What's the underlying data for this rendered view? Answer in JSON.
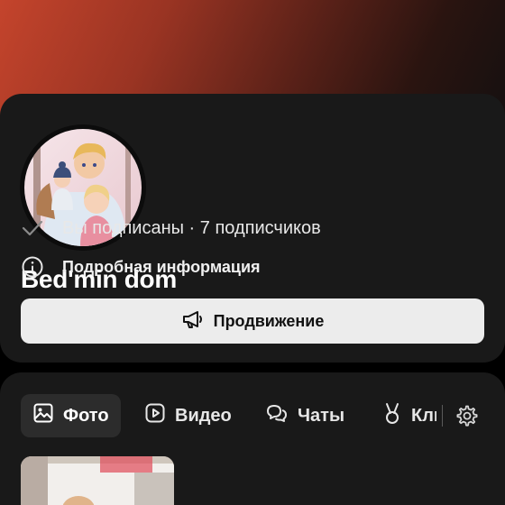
{
  "profile": {
    "title": "Bed'min dom",
    "subscription_text": "Вы подписаны · 7 подписчиков",
    "info_text": "Подробная информация",
    "promo_button_label": "Продвижение"
  },
  "tabs": [
    {
      "label": "Фото",
      "icon": "image-icon",
      "active": true
    },
    {
      "label": "Видео",
      "icon": "play-icon",
      "active": false
    },
    {
      "label": "Чаты",
      "icon": "chat-icon",
      "active": false
    },
    {
      "label": "Клипы",
      "icon": "clips-icon",
      "active": false
    }
  ],
  "colors": {
    "cover_gradient_start": "#c4442c",
    "card_background": "#191919",
    "button_background": "#ececec"
  }
}
